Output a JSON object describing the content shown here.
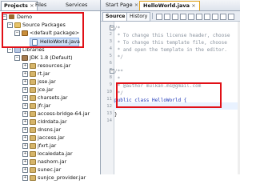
{
  "left_panel": {
    "tabs": [
      {
        "label": "Projects"
      },
      {
        "label": "Files"
      },
      {
        "label": "Services"
      }
    ],
    "close_glyph": "×",
    "tree": [
      {
        "label": "Demo",
        "icon": "project-icon",
        "expanded": true
      },
      {
        "label": "Source Packages",
        "icon": "folder-icon",
        "expanded": true
      },
      {
        "label": "<default package>",
        "icon": "package-icon",
        "expanded": true
      },
      {
        "label": "HelloWorld.java",
        "icon": "java-file-icon",
        "selected": true
      },
      {
        "label": "Libraries",
        "icon": "library-icon",
        "expanded": true
      },
      {
        "label": "JDK 1.8 (Default)",
        "icon": "jdk-icon",
        "expanded": true
      },
      {
        "label": "resources.jar",
        "icon": "jar-icon"
      },
      {
        "label": "rt.jar",
        "icon": "jar-icon"
      },
      {
        "label": "jsse.jar",
        "icon": "jar-icon"
      },
      {
        "label": "jce.jar",
        "icon": "jar-icon"
      },
      {
        "label": "charsets.jar",
        "icon": "jar-icon"
      },
      {
        "label": "jfr.jar",
        "icon": "jar-icon"
      },
      {
        "label": "access-bridge-64.jar",
        "icon": "jar-icon"
      },
      {
        "label": "cldrdata.jar",
        "icon": "jar-icon"
      },
      {
        "label": "dnsns.jar",
        "icon": "jar-icon"
      },
      {
        "label": "jaccess.jar",
        "icon": "jar-icon"
      },
      {
        "label": "jfxrt.jar",
        "icon": "jar-icon"
      },
      {
        "label": "localedata.jar",
        "icon": "jar-icon"
      },
      {
        "label": "nashorn.jar",
        "icon": "jar-icon"
      },
      {
        "label": "sunec.jar",
        "icon": "jar-icon"
      },
      {
        "label": "sunjce_provider.jar",
        "icon": "jar-icon"
      }
    ]
  },
  "editor": {
    "tabs": [
      {
        "label": "Start Page"
      },
      {
        "label": "HelloWorld.java"
      }
    ],
    "close_glyph": "×",
    "toolbar": {
      "source_label": "Source",
      "history_label": "History"
    },
    "lines": [
      {
        "n": "1",
        "text": "/*"
      },
      {
        "n": "2",
        "text": " * To change this license header, choose"
      },
      {
        "n": "3",
        "text": " * To change this template file, choose"
      },
      {
        "n": "4",
        "text": " * and open the template in the editor."
      },
      {
        "n": "5",
        "text": " */"
      },
      {
        "n": "6",
        "text": ""
      },
      {
        "n": "7",
        "text": "/**"
      },
      {
        "n": "8",
        "text": " *"
      },
      {
        "n": "9",
        "text": " * @author mulkan.ms@gmail.com"
      },
      {
        "n": "10",
        "text": " */"
      },
      {
        "n": "11",
        "text": "public class HelloWorld {"
      },
      {
        "n": "12",
        "text": ""
      },
      {
        "n": "13",
        "text": "}"
      },
      {
        "n": "14",
        "text": ""
      }
    ]
  },
  "colors": {
    "highlight_red": "#e10f16",
    "keyword_blue": "#1b35b8",
    "comment_gray": "#8a939e"
  }
}
